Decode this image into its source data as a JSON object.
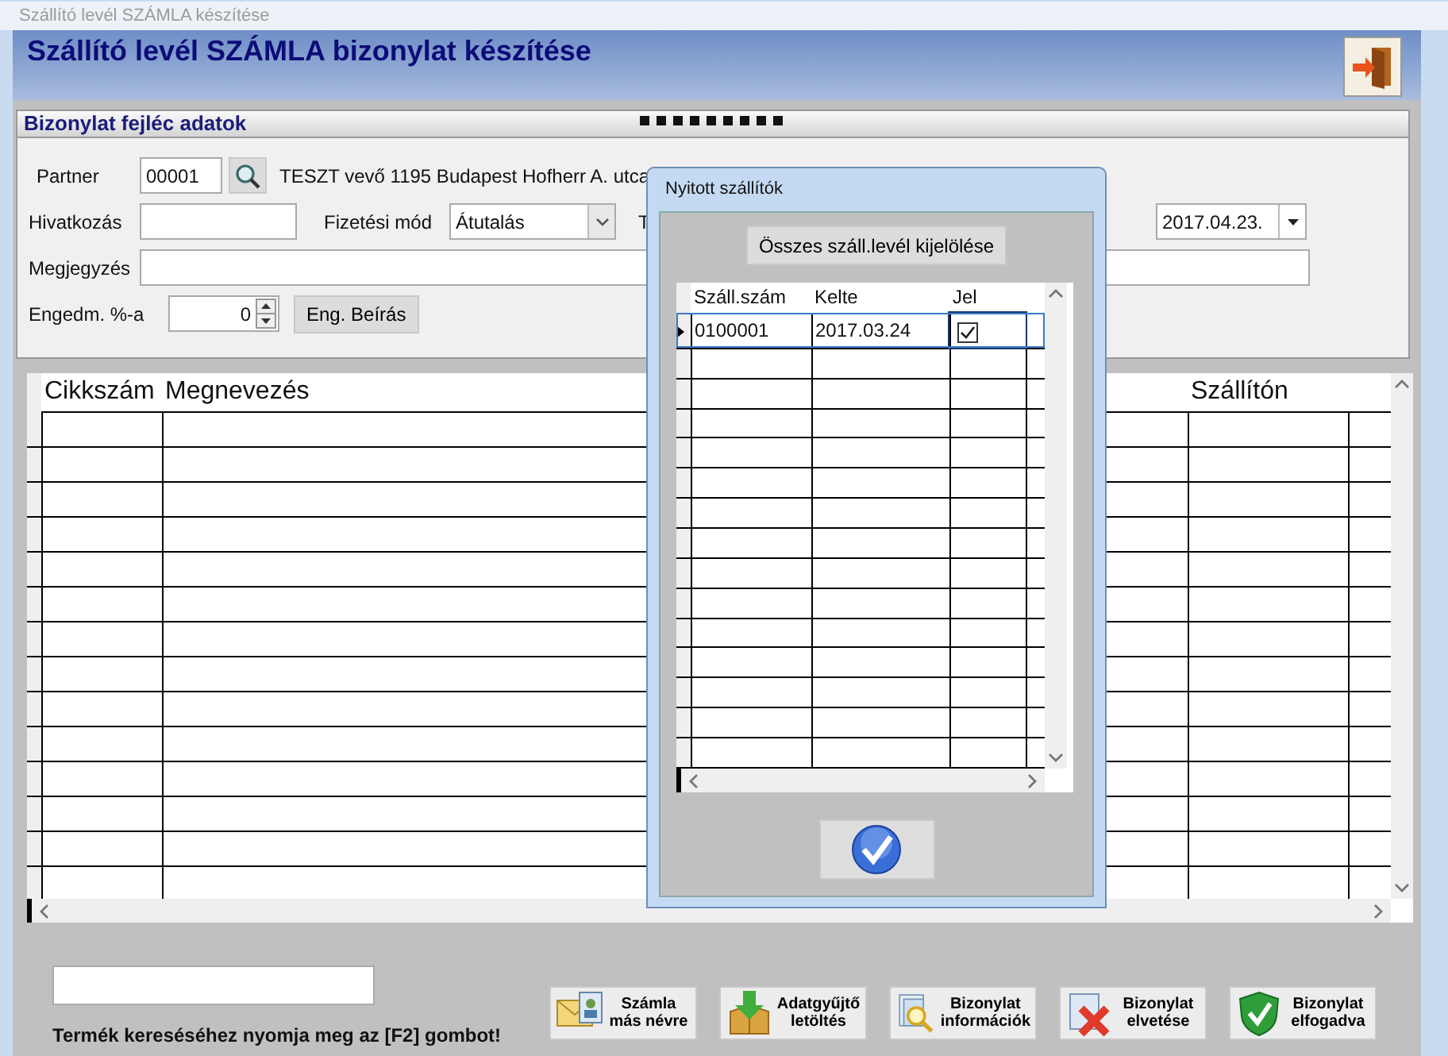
{
  "window": {
    "title": "Szállító levél SZÁMLA készítése"
  },
  "header": {
    "title": "Szállító levél SZÁMLA bizonylat készítése"
  },
  "section": {
    "title": "Bizonylat fejléc adatok"
  },
  "form": {
    "partner_label": "Partner",
    "partner_code": "00001",
    "partner_text": "TESZT vevő 1195 Budapest Hofherr A. utca",
    "reference_label": "Hivatkozás",
    "payment_label": "Fizetési mód",
    "payment_value": "Átutalás",
    "cut_label": "T",
    "date_value": "2017.04.23.",
    "note_label": "Megjegyzés",
    "discount_label": "Engedm. %-a",
    "discount_value": "0",
    "discount_button": "Eng. Beírás"
  },
  "items_grid": {
    "columns": [
      "Cikkszám",
      "Megnevezés",
      "Szállítón"
    ]
  },
  "footer": {
    "hint": "Termék kereséséhez nyomja meg az [F2] gombot!"
  },
  "actions": [
    {
      "kind": "rename",
      "label": "Számla más névre"
    },
    {
      "kind": "download",
      "label": "Adatgyűjtő letöltés"
    },
    {
      "kind": "info",
      "label": "Bizonylat információk"
    },
    {
      "kind": "discard",
      "label": "Bizonylat elvetése"
    },
    {
      "kind": "accept",
      "label": "Bizonylat elfogadva"
    }
  ],
  "dialog": {
    "title": "Nyitott szállítók",
    "select_all_button": "Összes száll.levél kijelölése",
    "columns": [
      "Száll.szám",
      "Kelte",
      "Jel"
    ],
    "rows": [
      {
        "number": "0100001",
        "date": "2017.03.24",
        "checked": true,
        "selected": true
      }
    ]
  }
}
